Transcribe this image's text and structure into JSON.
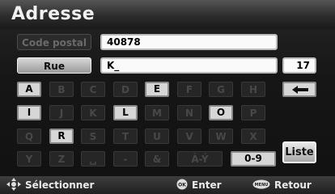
{
  "header": {
    "title": "Adresse"
  },
  "fields": {
    "postal_label": "Code postal",
    "postal_value": "40878",
    "street_label": "Rue",
    "street_value": "K_",
    "street_count": "17"
  },
  "keyboard": {
    "rows": [
      [
        {
          "label": "A",
          "state": "on"
        },
        {
          "label": "B",
          "state": "off"
        },
        {
          "label": "C",
          "state": "off"
        },
        {
          "label": "D",
          "state": "off"
        },
        {
          "label": "E",
          "state": "on"
        },
        {
          "label": "F",
          "state": "off"
        },
        {
          "label": "G",
          "state": "off"
        },
        {
          "label": "H",
          "state": "off"
        }
      ],
      [
        {
          "label": "I",
          "state": "on"
        },
        {
          "label": "J",
          "state": "off"
        },
        {
          "label": "K",
          "state": "off"
        },
        {
          "label": "L",
          "state": "on"
        },
        {
          "label": "M",
          "state": "off"
        },
        {
          "label": "N",
          "state": "off"
        },
        {
          "label": "O",
          "state": "on"
        },
        {
          "label": "P",
          "state": "off"
        }
      ],
      [
        {
          "label": "Q",
          "state": "off"
        },
        {
          "label": "R",
          "state": "on"
        },
        {
          "label": "S",
          "state": "off"
        },
        {
          "label": "T",
          "state": "off"
        },
        {
          "label": "U",
          "state": "off"
        },
        {
          "label": "V",
          "state": "off"
        },
        {
          "label": "W",
          "state": "off"
        },
        {
          "label": "X",
          "state": "off"
        }
      ],
      [
        {
          "label": "Y",
          "state": "off"
        },
        {
          "label": "Z",
          "state": "off"
        },
        {
          "label": "␣",
          "state": "off"
        },
        {
          "label": "-",
          "state": "off"
        },
        {
          "label": "&",
          "state": "off"
        },
        {
          "label": "À-Ý",
          "state": "off"
        },
        {
          "label": "0-9",
          "state": "on"
        }
      ]
    ],
    "backspace_icon": "backspace-arrow-icon",
    "list_label": "Liste"
  },
  "footer": {
    "select_label": "Sélectionner",
    "enter_label": "Enter",
    "enter_icon_text": "OK",
    "return_label": "Retour",
    "return_icon_text": "MENU"
  },
  "colors": {
    "active_key": "#d6d6d6",
    "inactive_key": "#262626",
    "background": "#161616"
  }
}
